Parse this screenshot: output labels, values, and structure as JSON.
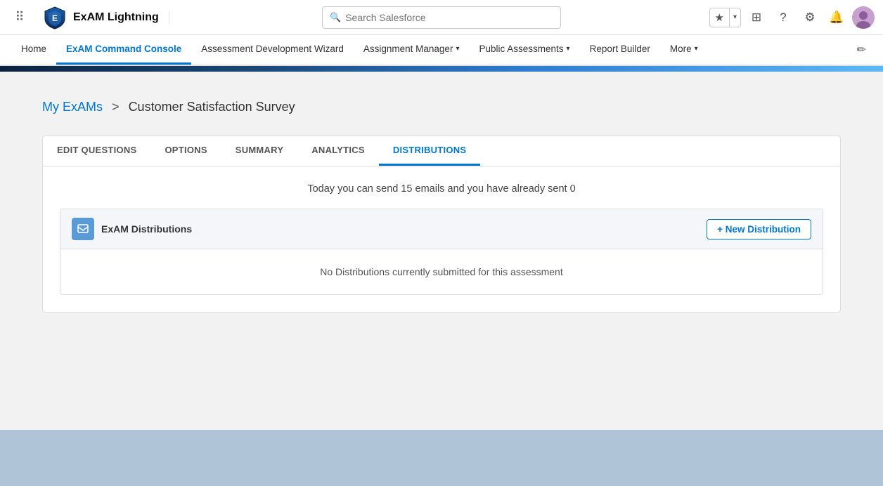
{
  "app": {
    "name": "ExAM Lightning",
    "shield_icon": "🛡"
  },
  "search": {
    "placeholder": "Search Salesforce"
  },
  "utility_icons": {
    "star": "★",
    "chevron": "▾",
    "plus": "+",
    "question": "?",
    "gear": "⚙",
    "bell": "🔔"
  },
  "nav": {
    "items": [
      {
        "label": "Home",
        "active": false
      },
      {
        "label": "ExAM Command Console",
        "active": true
      },
      {
        "label": "Assessment Development Wizard",
        "active": false
      },
      {
        "label": "Assignment Manager",
        "active": false,
        "has_chevron": true
      },
      {
        "label": "Public Assessments",
        "active": false,
        "has_chevron": true
      },
      {
        "label": "Report Builder",
        "active": false
      },
      {
        "label": "More",
        "active": false,
        "has_chevron": true
      }
    ]
  },
  "breadcrumb": {
    "link_text": "My ExAMs",
    "separator": ">",
    "current": "Customer Satisfaction Survey"
  },
  "tabs": [
    {
      "label": "EDIT QUESTIONS",
      "active": false
    },
    {
      "label": "OPTIONS",
      "active": false
    },
    {
      "label": "SUMMARY",
      "active": false
    },
    {
      "label": "ANALYTICS",
      "active": false
    },
    {
      "label": "DISTRIBUTIONS",
      "active": true
    }
  ],
  "distributions": {
    "email_notice": "Today you can send 15 emails and you have already sent 0",
    "card_title": "ExAM Distributions",
    "new_button": "+ New Distribution",
    "empty_message": "No Distributions currently submitted for this assessment"
  }
}
